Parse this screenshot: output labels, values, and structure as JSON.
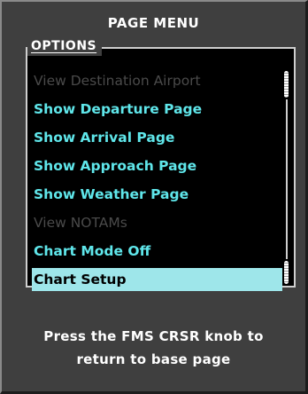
{
  "title": "PAGE MENU",
  "options_label": "OPTIONS",
  "items": [
    {
      "label": "View Destination Airport",
      "state": "disabled"
    },
    {
      "label": "Show Departure Page",
      "state": "enabled"
    },
    {
      "label": "Show Arrival Page",
      "state": "enabled"
    },
    {
      "label": "Show Approach Page",
      "state": "enabled"
    },
    {
      "label": "Show Weather Page",
      "state": "enabled"
    },
    {
      "label": "View NOTAMs",
      "state": "disabled"
    },
    {
      "label": "Chart Mode Off",
      "state": "enabled"
    },
    {
      "label": "Chart Setup",
      "state": "selected"
    }
  ],
  "footer": {
    "line1": "Press the FMS CRSR knob to",
    "line2": "return to base page"
  },
  "colors": {
    "panel": "#3f3f3f",
    "list_background": "#000000",
    "enabled_text": "#5fe6ea",
    "disabled_text": "#4a4a4a",
    "selected_background": "#9ee6ea",
    "selected_text": "#000000",
    "header_text": "#ffffff"
  }
}
